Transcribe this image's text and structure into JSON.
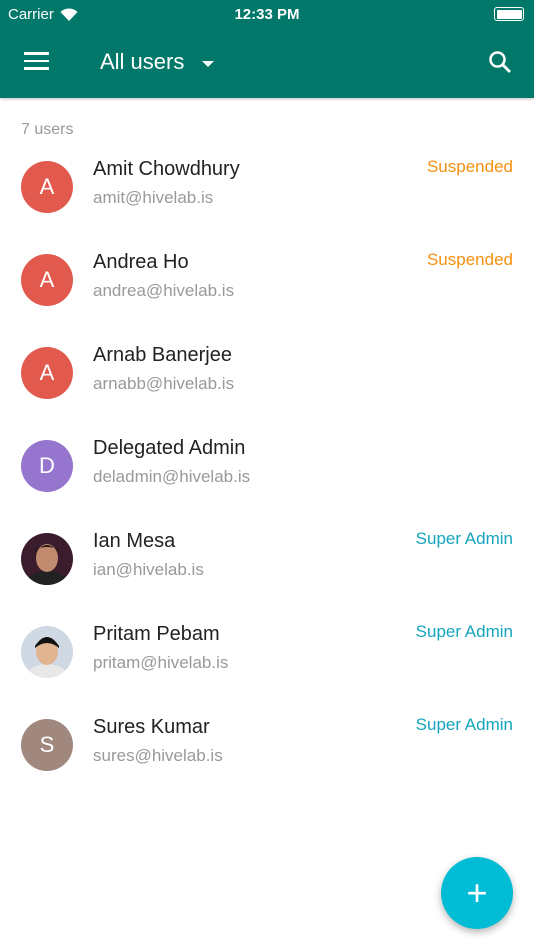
{
  "status": {
    "carrier": "Carrier",
    "time": "12:33 PM"
  },
  "header": {
    "title": "All users"
  },
  "count": "7 users",
  "colors": {
    "appbar": "#02786a",
    "suspended": "#f5900f",
    "super_admin": "#14a5bd",
    "fab": "#00bcd4"
  },
  "users": [
    {
      "initial": "A",
      "name": "Amit Chowdhury",
      "email": "amit@hivelab.is",
      "badge": "Suspended",
      "avatar_color": "#e25a4e"
    },
    {
      "initial": "A",
      "name": "Andrea Ho",
      "email": "andrea@hivelab.is",
      "badge": "Suspended",
      "avatar_color": "#e25a4e"
    },
    {
      "initial": "A",
      "name": "Arnab Banerjee",
      "email": "arnabb@hivelab.is",
      "badge": "",
      "avatar_color": "#e25a4e"
    },
    {
      "initial": "D",
      "name": "Delegated Admin",
      "email": "deladmin@hivelab.is",
      "badge": "",
      "avatar_color": "#9575cd"
    },
    {
      "initial": "",
      "name": "Ian Mesa",
      "email": "ian@hivelab.is",
      "badge": "Super Admin",
      "avatar_color": "#3a1c2c"
    },
    {
      "initial": "",
      "name": "Pritam Pebam",
      "email": "pritam@hivelab.is",
      "badge": "Super Admin",
      "avatar_color": "#cfd8e3"
    },
    {
      "initial": "S",
      "name": "Sures Kumar",
      "email": "sures@hivelab.is",
      "badge": "Super Admin",
      "avatar_color": "#a1887f"
    }
  ],
  "fab": {
    "label": "+"
  }
}
